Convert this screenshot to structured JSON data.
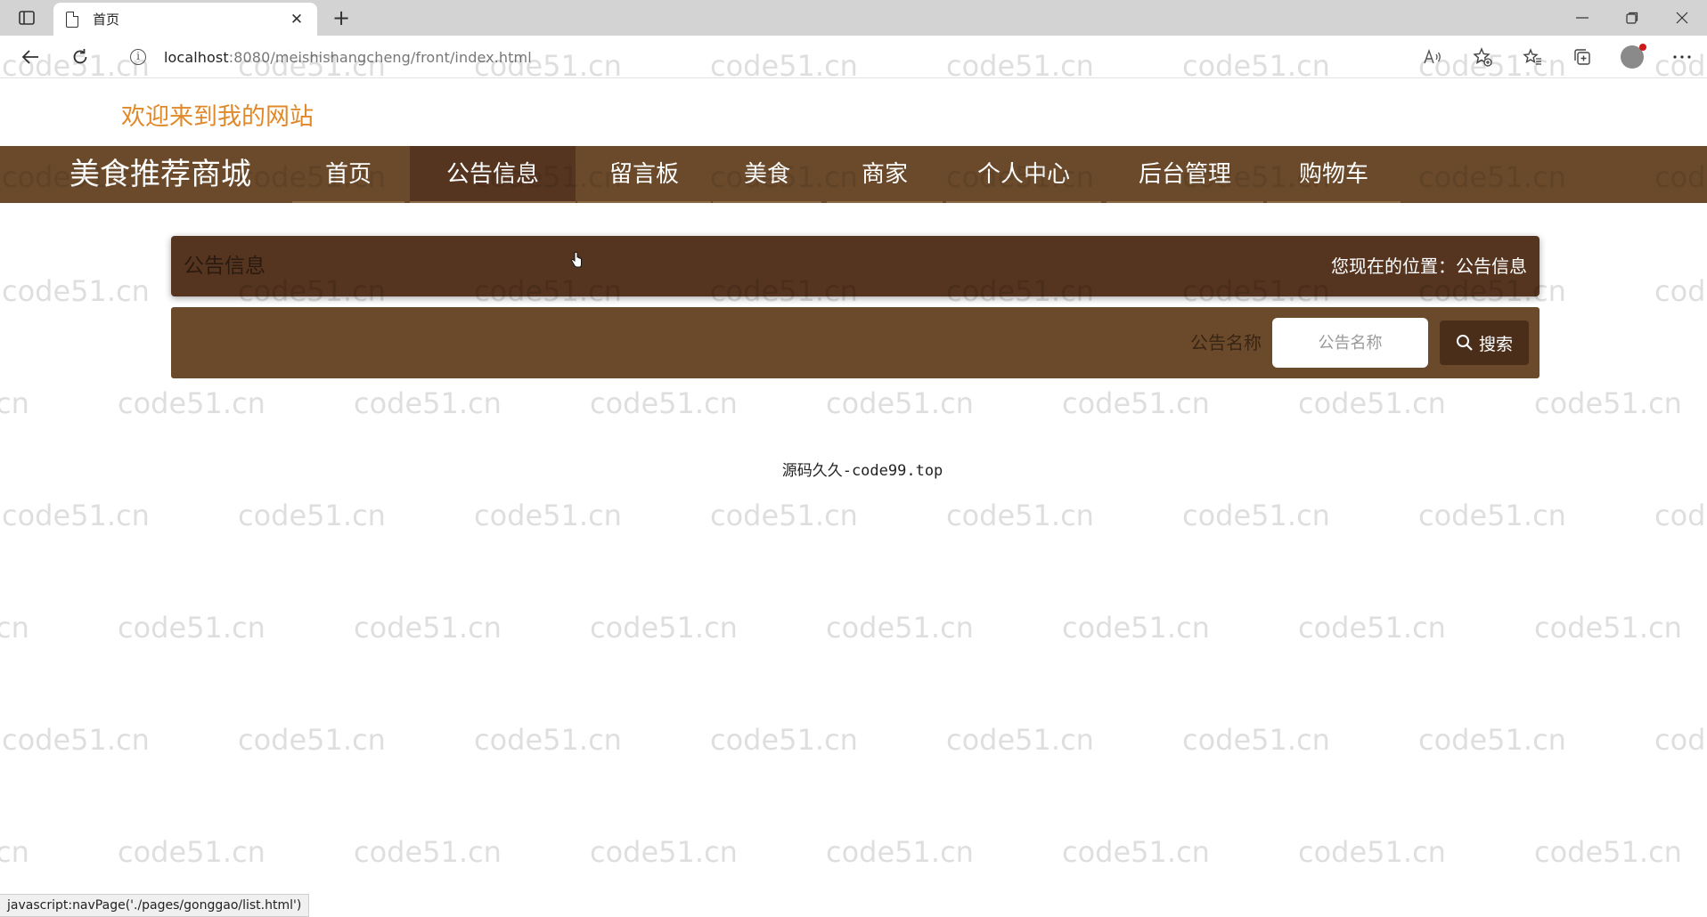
{
  "browser": {
    "tab_title": "首页",
    "tab_close": "✕",
    "new_tab": "+",
    "url_host": "localhost",
    "url_path": ":8080/meishishangcheng/front/index.html",
    "status_url": "javascript:navPage('./pages/gonggao/list.html')"
  },
  "site": {
    "welcome": "欢迎来到我的网站",
    "brand": "美食推荐商城",
    "nav": [
      {
        "label": "首页"
      },
      {
        "label": "公告信息"
      },
      {
        "label": "留言板"
      },
      {
        "label": "美食"
      },
      {
        "label": "商家"
      },
      {
        "label": "个人中心"
      },
      {
        "label": "后台管理"
      },
      {
        "label": "购物车"
      }
    ],
    "active_nav": "公告信息"
  },
  "breadcrumb": {
    "title": "公告信息",
    "location": "您现在的位置：公告信息"
  },
  "search": {
    "label": "公告名称",
    "placeholder": "公告名称",
    "button_label": "搜索"
  },
  "footer": {
    "text": "源码久久-code99.top"
  },
  "watermark": {
    "text": "code51.cn"
  },
  "colors": {
    "nav_bg": "#6b4a2b",
    "nav_active": "#553520",
    "welcome": "#e0892a"
  }
}
